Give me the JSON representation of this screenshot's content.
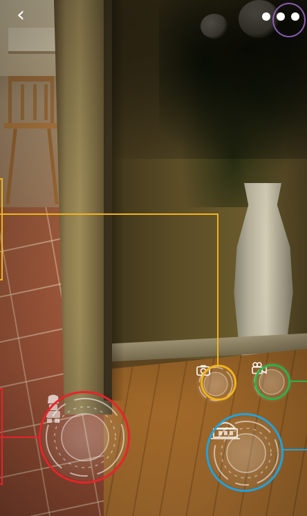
{
  "nav": {
    "back_glyph": "‹",
    "back_icon": "chevron-left-icon",
    "more_icon": "ellipsis-icon"
  },
  "ar_controls": {
    "photo": {
      "icon": "camera-icon",
      "highlight_color": "#f2b51c"
    },
    "video": {
      "icon": "video-camera-icon",
      "highlight_color": "#2bb24c"
    },
    "character": {
      "icon": "robot-figure-icon",
      "highlight_color": "#e8232a"
    },
    "scene": {
      "icon": "building-scene-icon",
      "highlight_color": "#1fa3e0"
    }
  },
  "annotations": {
    "more_menu_color": "#8e5bb5",
    "callout_yellow": "#f2b51c",
    "callout_green": "#2bb24c",
    "callout_red": "#e8232a",
    "callout_blue": "#1fa3e0"
  }
}
